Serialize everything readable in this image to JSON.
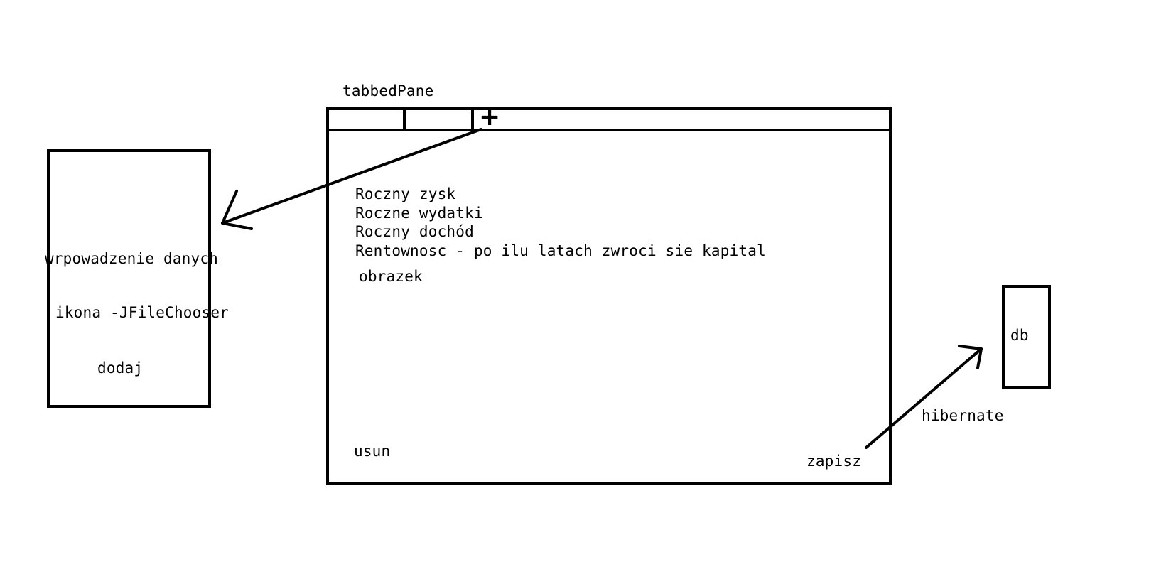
{
  "main_window": {
    "caption": "tabbedPane",
    "tabs": [
      {
        "label": ""
      },
      {
        "label": ""
      }
    ],
    "add_tab_glyph": "+",
    "content": {
      "line_1": "Roczny zysk",
      "line_2": "Roczne wydatki",
      "line_3": "Roczny dochód",
      "line_4": "Rentownosc - po ilu latach zwroci sie kapital",
      "image_label": "obrazek",
      "delete_label": "usun",
      "save_label": "zapisz"
    }
  },
  "input_dialog": {
    "title": "wrpowadzenie danych",
    "icon_label": "ikona -JFileChooser",
    "add_label": "dodaj"
  },
  "database": {
    "label": "db",
    "link_label": "hibernate"
  }
}
